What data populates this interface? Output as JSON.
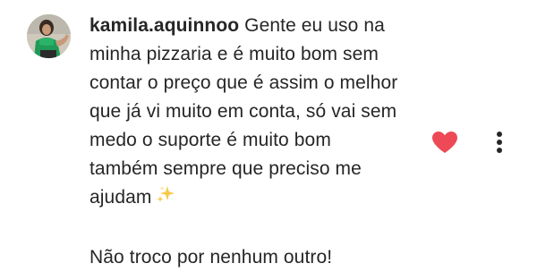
{
  "comment": {
    "username": "kamila.aquinnoo",
    "lines": [
      "Gente eu uso na",
      "minha pizzaria e é muito bom sem",
      "contar o preço que é assim o melhor",
      "que já vi muito em conta, só vai sem",
      "medo o suporte é muito bom",
      "também sempre que preciso me",
      "ajudam"
    ],
    "last_line": "Não troco por nenhum outro!",
    "emoji": "sparkles-icon"
  },
  "actions": {
    "like_icon": "heart-icon",
    "liked": true,
    "like_color": "#ED4956",
    "more_icon": "vertical-ellipsis-icon"
  }
}
